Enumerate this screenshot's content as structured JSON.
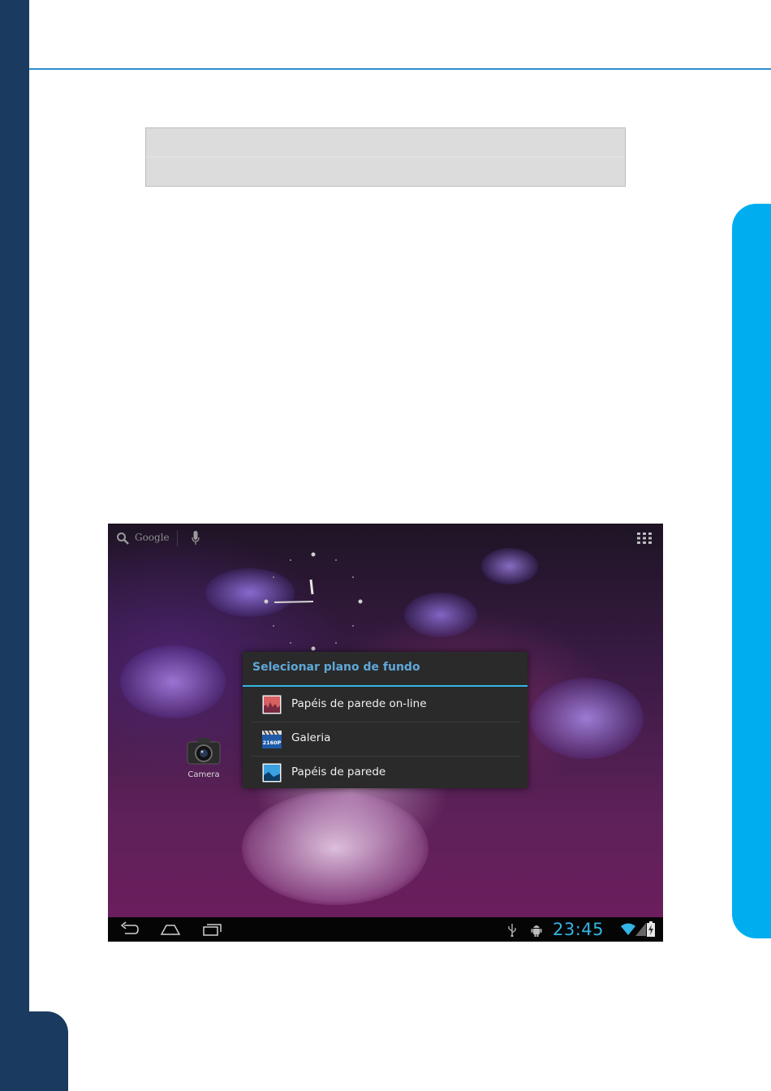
{
  "tablet": {
    "search": {
      "provider_label": "Google"
    },
    "home": {
      "camera_label": "Camera"
    },
    "dialog": {
      "title": "Selecionar plano de fundo",
      "items": [
        {
          "label": "Papéis de parede on-line",
          "icon": "online-wallpapers-icon"
        },
        {
          "label": "Galeria",
          "icon": "gallery-icon"
        },
        {
          "label": "Papéis de parede",
          "icon": "wallpapers-icon"
        }
      ]
    },
    "status": {
      "time": "23:45"
    }
  },
  "colors": {
    "page_left_bar": "#1b3a5f",
    "page_right_tab": "#00aeef",
    "rule": "#2b8fd0",
    "holo_accent": "#33b5e5",
    "dialog_bg": "#2a2a2a"
  }
}
